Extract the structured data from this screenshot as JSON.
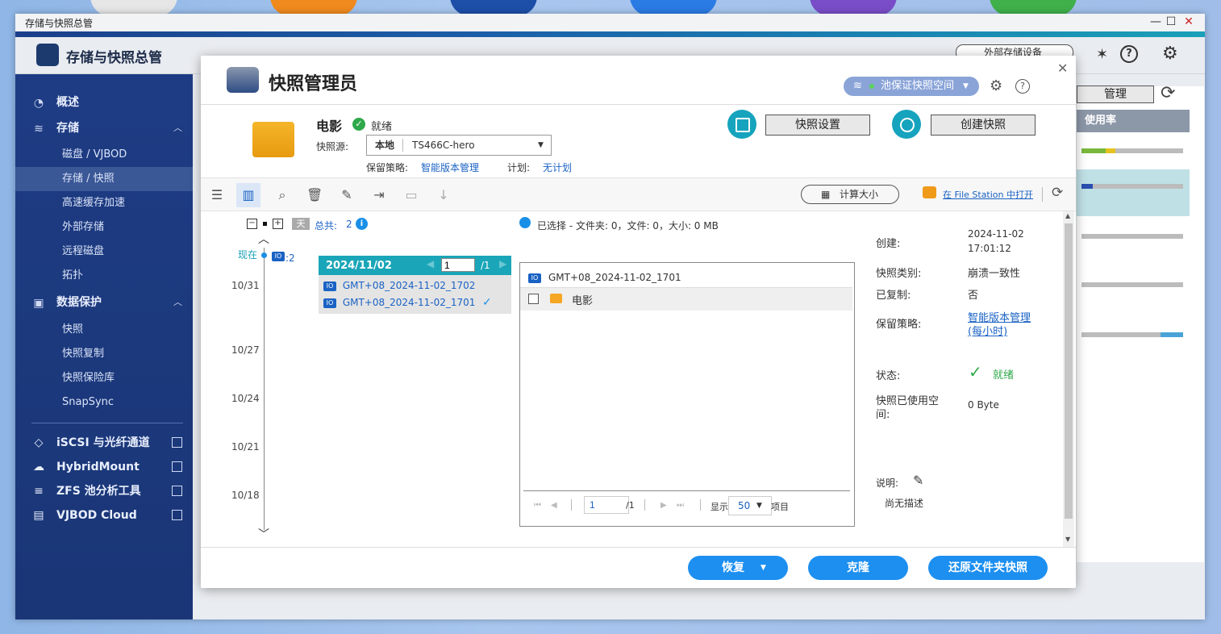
{
  "window": {
    "title": "存储与快照总管",
    "app_title": "存储与快照总管"
  },
  "app_header": {
    "external_storage": "外部存储设备"
  },
  "sidebar": {
    "overview": "概述",
    "storage": "存储",
    "storage_items": [
      "磁盘 / VJBOD",
      "存储 / 快照",
      "高速缓存加速",
      "外部存储",
      "远程磁盘",
      "拓扑"
    ],
    "data_protection": "数据保护",
    "protection_items": [
      "快照",
      "快照复制",
      "快照保险库",
      "SnapSync"
    ],
    "external": [
      "iSCSI 与光纤通道",
      "HybridMount",
      "ZFS 池分析工具",
      "VJBOD Cloud"
    ]
  },
  "right_panel": {
    "manage_button": "管理",
    "column_usage": "使用率"
  },
  "dialog": {
    "title": "快照管理员",
    "pool_dropdown": "池保证快照空间",
    "volume": {
      "name": "电影",
      "status": "就绪",
      "source_label": "快照源:",
      "source_local": "本地",
      "source_value": "TS466C-hero",
      "retention_label": "保留策略:",
      "retention_value": "智能版本管理",
      "schedule_label": "计划:",
      "schedule_value": "无计划"
    },
    "buttons": {
      "snapshot_settings": "快照设置",
      "create_snapshot": "创建快照",
      "calc_size": "计算大小",
      "open_file_station": "在 File Station 中打开",
      "restore": "恢复",
      "clone": "克隆",
      "restore_folder": "还原文件夹快照"
    },
    "timeline": {
      "day_label": "天",
      "total_label": "总共:",
      "total": "2",
      "now": "现在",
      "now_count": ":2",
      "dates": [
        "10/31",
        "10/27",
        "10/24",
        "10/21",
        "10/18"
      ]
    },
    "day_panel": {
      "date": "2024/11/02",
      "page": "1",
      "page_total": "/1",
      "snapshots": [
        "GMT+08_2024-11-02_1702",
        "GMT+08_2024-11-02_1701"
      ]
    },
    "selection": "已选择 - 文件夹: 0，文件: 0，大小: 0 MB",
    "browser": {
      "snapshot": "GMT+08_2024-11-02_1701",
      "folder": "电影",
      "page": "1",
      "page_total": "/1",
      "show_label": "显示",
      "per_page": "50",
      "items_label": "项目"
    },
    "details": {
      "created_label": "创建:",
      "created_date": "2024-11-02",
      "created_time": "17:01:12",
      "type_label": "快照类别:",
      "type_value": "崩溃一致性",
      "copied_label": "已复制:",
      "copied_value": "否",
      "retention_label": "保留策略:",
      "retention_value": "智能版本管理",
      "retention_sub": "(每小时)",
      "state_label": "状态:",
      "state_value": "就绪",
      "used_label_1": "快照已使用空",
      "used_label_2": "间:",
      "used_value": "0 Byte",
      "desc_label": "说明:",
      "desc_value": "尚无描述"
    }
  }
}
